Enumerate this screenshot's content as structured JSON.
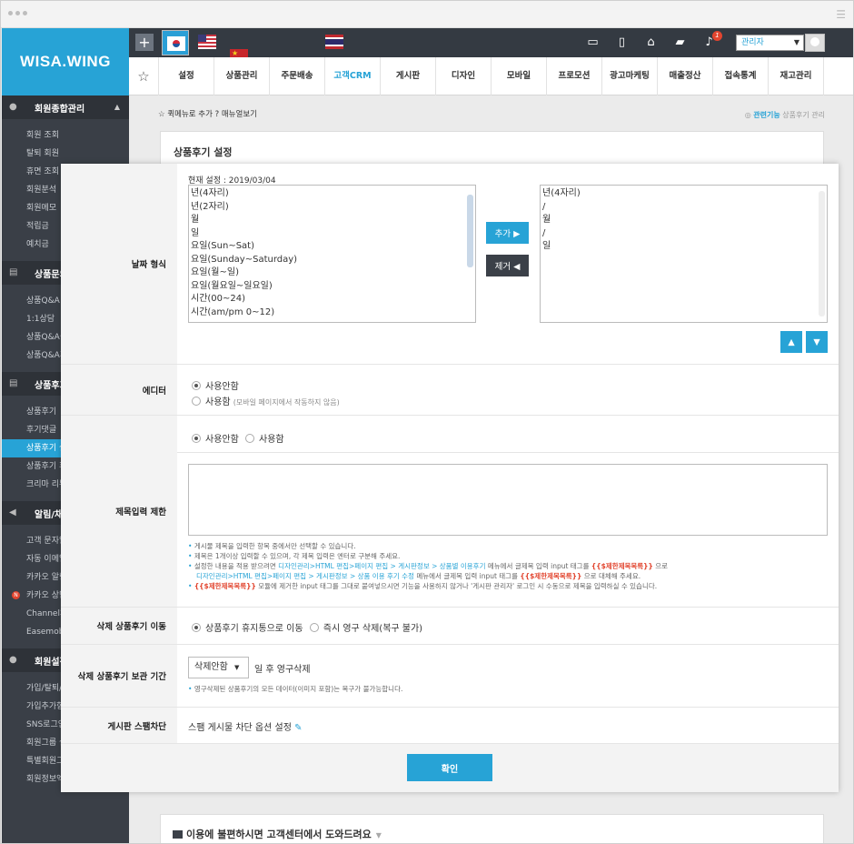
{
  "logo": "WISA.WING",
  "sidebar": {
    "sections": [
      {
        "title": "회원종합관리",
        "items": [
          "회원 조회",
          "탈퇴 회원",
          "휴면 조회",
          "회원분석",
          "회원메모",
          "적립금",
          "예치금"
        ]
      },
      {
        "title": "상품문의",
        "items": [
          "상품Q&A",
          "1:1상담",
          "상품Q&A설정",
          "상품Q&A휴"
        ]
      },
      {
        "title": "상품후기",
        "items": [
          "상품후기",
          "후기댓글",
          "상품후기 설",
          "상품후기 휴",
          "크리마 리뷰"
        ]
      },
      {
        "title": "알림/채",
        "items": [
          "고객 문자알",
          "자동 이메일",
          "카카오 알림",
          "카카오 상담",
          "Channel채팅",
          "Easemob채"
        ]
      },
      {
        "title": "회원설정",
        "items": [
          "가입/탈퇴/S",
          "가입추가항",
          "SNS로그인 설",
          "회원그룹 설",
          "특별회원그",
          "회원정보엑"
        ]
      }
    ],
    "active_item": "상품후기 설"
  },
  "topbar": {
    "admin_label": "관리자",
    "notification_count": "1",
    "flags": [
      "kr-flag",
      "us-flag",
      "cn-flag",
      "cn-flag",
      "jp-flag",
      "th-flag"
    ]
  },
  "nav": {
    "tabs": [
      "설정",
      "상품관리",
      "주문배송",
      "고객CRM",
      "게시판",
      "디자인",
      "모바일",
      "프로모션",
      "광고마케팅",
      "매출정산",
      "접속통계",
      "재고관리"
    ],
    "active": "고객CRM"
  },
  "quickmenu": "☆ 퀵메뉴로 추가 ? 매뉴얼보기",
  "related": {
    "label": "관련기능",
    "link": "상품후기 관리"
  },
  "panel_title": "상품후기 설정",
  "date_format": {
    "label": "날짜 형식",
    "current": "현재 설정 : 2019/03/04",
    "options": [
      "년(4자리)",
      "년(2자리)",
      "월",
      "일",
      "요일(Sun~Sat)",
      "요일(Sunday~Saturday)",
      "요일(월~일)",
      "요일(월요일~일요일)",
      "시간(00~24)",
      "시간(am/pm 0~12)"
    ],
    "selected": [
      "년(4자리)",
      "/",
      "월",
      "/",
      "일"
    ],
    "add_btn": "추가 ▶",
    "remove_btn": "제거 ◀",
    "up": "▲",
    "down": "▼"
  },
  "editor": {
    "label": "에디터",
    "opt1": "사용안함",
    "opt2": "사용함",
    "opt2_note": "(모바일 페이지에서 작동하지 않음)"
  },
  "title_limit": {
    "label": "제목입력 제한",
    "opt1": "사용안함",
    "opt2": "사용함",
    "note1": "게시물 제목을 입력한 항목 중에서만 선택할 수 있습니다.",
    "note2": "제목은 1개이상 입력할 수 있으며, 각 제목 입력은 엔터로 구분해 주세요.",
    "note3_a": "설정한 내용을 적용 받으려면",
    "note3_b": "디자인관리>HTML 편집>페이지 편집 > 게시판정보 > 상품별 이용후기",
    "note3_c": "메뉴에서 글제목 입력 input 태그를",
    "note3_d": "{{$제한제목목록}}",
    "note3_e": "으로",
    "note4_b": "디자인관리>HTML 편집>페이지 편집 > 게시판정보 > 상품 이용 후기 수정",
    "note4_c": "메뉴에서 글제목 입력 input 태그를",
    "note4_d": "{{$제한제목목록}}",
    "note4_e": "으로 대체해 주세요.",
    "note5_a": "{{$제한제목목록}}",
    "note5_b": "모듈에 제거한 input 태그를 그대로 붙여넣으시면 기능을 사용하지 않거나 '게시판 관리자' 로그인 시 수동으로 제목을 입력하실 수 있습니다."
  },
  "delete_move": {
    "label": "삭제 상품후기 이동",
    "opt1": "상품후기 휴지통으로 이동",
    "opt2": "즉시 영구 삭제(복구 불가)"
  },
  "delete_keep": {
    "label": "삭제 상품후기 보관 기간",
    "select": "삭제안함",
    "suffix": "일 후 영구삭제",
    "note": "영구삭제된 상품후기의 모든 데이터(이미지 포함)는 복구가 불가능합니다."
  },
  "spam": {
    "label": "게시판 스팸차단",
    "text": "스팸 게시물 차단 옵션 설정"
  },
  "confirm_btn": "확인",
  "help": "이용에 불편하시면 고객센터에서 도와드려요"
}
